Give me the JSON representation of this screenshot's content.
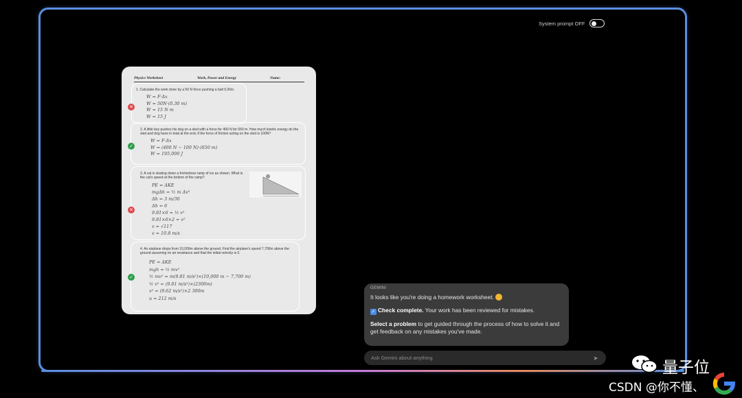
{
  "system_prompt": {
    "label": "System prompt OFF",
    "state": "off"
  },
  "worksheet": {
    "header": {
      "left": "Physics Worksheet",
      "center": "Work, Power and Energy",
      "right": "Name:"
    },
    "questions": [
      {
        "text": "1. Calculate the work done by a 50 N force pushing a ball 0.26m.",
        "work": [
          "W = F·Δx",
          "W = 50N·(0.30 m)",
          "W = 15 N m",
          "W = 15 J"
        ],
        "status": "wrong"
      },
      {
        "text": "2. A little boy pushes his dog on a sled with a force for 400 N for 650 m. How much kinetic energy do the sled and dog have in total at the end, if the force of friction acting on the sled is 100N?",
        "work": [
          "W = F·Δx",
          "W = (400 N − 100 N)·(650 m)",
          "W = 195,000 J"
        ],
        "status": "right"
      },
      {
        "text": "3. A cat is skating down a frictionless ramp of ice as shown. What is the cat's speed at the bottom of the ramp?",
        "work": [
          "PE = ΔKE",
          "mgΔh = ½ m Δv²",
          "Δh = 3 m/30",
          "Δh = 6",
          "9.81×6 = ½ v²",
          "9.81×6×2 = v²",
          "v = √117",
          "v = 10.8 m/s"
        ],
        "status": "wrong"
      },
      {
        "text": "4. An airplane drops from 10,000m above the ground. Find the airplane's speed 7,700m above the ground assuming no air resistance and that the initial velocity is 0.",
        "work": [
          "PE = ΔKE",
          "mgh = ½ mv²",
          "½ mv² = m(9.81 m/s²)×(10,000 m − 7,700 m)",
          "½ v² = (9.81 m/s²)×(2300m)",
          "v² = (9.62 m/s²)×2 300m",
          "u = 212 m/s"
        ],
        "status": "right"
      }
    ]
  },
  "gemini": {
    "label": "GEMINI",
    "line1": "It looks like you're doing a homework worksheet.",
    "line2_bold": "Check complete.",
    "line2_rest": " Your work has been reviewed for mistakes.",
    "line3_bold": "Select a problem",
    "line3_rest": " to get guided through the process of how to solve it and get feedback on any mistakes you've made."
  },
  "input": {
    "placeholder": "Ask Gemini about anything"
  },
  "watermark": {
    "brand": "量子位",
    "csdn": "CSDN @你不懂、"
  },
  "colors": {
    "frame": "#5b8fe0",
    "wrong": "#e0464b",
    "right": "#2e9d4a",
    "card": "#3b3b3b"
  }
}
